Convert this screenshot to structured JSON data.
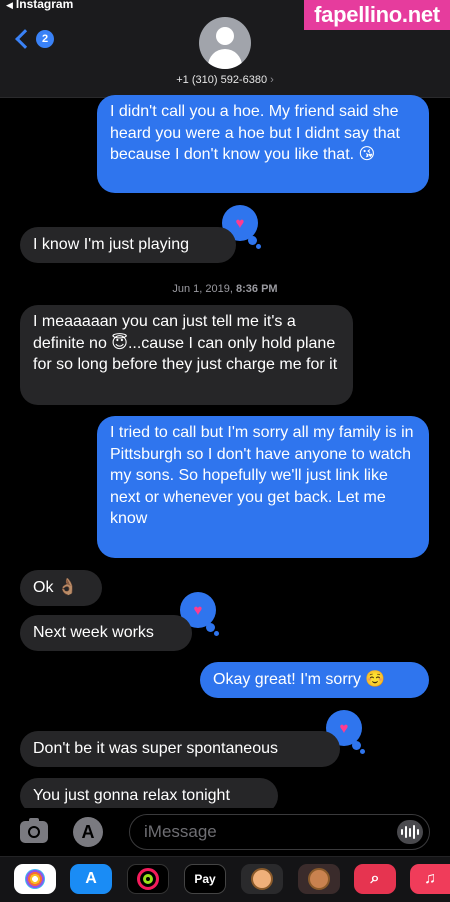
{
  "status": {
    "back_app": "Instagram"
  },
  "header": {
    "back_badge": "2",
    "contact_phone": "+1 (310) 592-6380",
    "phone_chevron": "›"
  },
  "watermark": "fapellino.net",
  "messages": [
    {
      "side": "sent",
      "text": "I didn't call you a hoe. My friend said she heard you were a hoe but I didnt say that because I don't know you like that. 😘"
    },
    {
      "side": "received",
      "text": "I know I'm just playing",
      "reaction": "heart"
    },
    {
      "side": "received",
      "text": "I meaaaaan you can just tell me it's a definite no 😇...cause I can only hold plane for so long before they just charge me for it"
    },
    {
      "side": "sent",
      "text": "I tried to call but I'm sorry all my family is in Pittsburgh so I don't have anyone to watch my sons. So hopefully we'll just link like next or whenever you get back. Let me know"
    },
    {
      "side": "received",
      "text": "Ok 👌🏽"
    },
    {
      "side": "received",
      "text": "Next week works",
      "reaction": "heart"
    },
    {
      "side": "sent",
      "text": "Okay great! I'm sorry ☺️"
    },
    {
      "side": "received",
      "text": "Don't be it was super spontaneous",
      "reaction": "heart"
    },
    {
      "side": "received",
      "text": "You just gonna relax tonight"
    }
  ],
  "timestamp": {
    "date": "Jun 1, 2019,",
    "time": "8:36 PM"
  },
  "composer": {
    "placeholder": "iMessage"
  },
  "app_drawer": {
    "apple_pay_label": "Pay",
    "music_glyph": "♫"
  },
  "colors": {
    "sent_bubble": "#2f75ee",
    "received_bubble": "#262628",
    "reaction_heart": "#ff3b8f",
    "watermark_bg": "#e63c9d"
  },
  "icons": [
    "camera-icon",
    "app-store-icon",
    "audio-waveform-icon",
    "photos-app-icon",
    "activity-rings-icon",
    "apple-pay-icon",
    "memoji-icon",
    "image-search-icon",
    "music-icon",
    "heart-reaction-icon"
  ]
}
